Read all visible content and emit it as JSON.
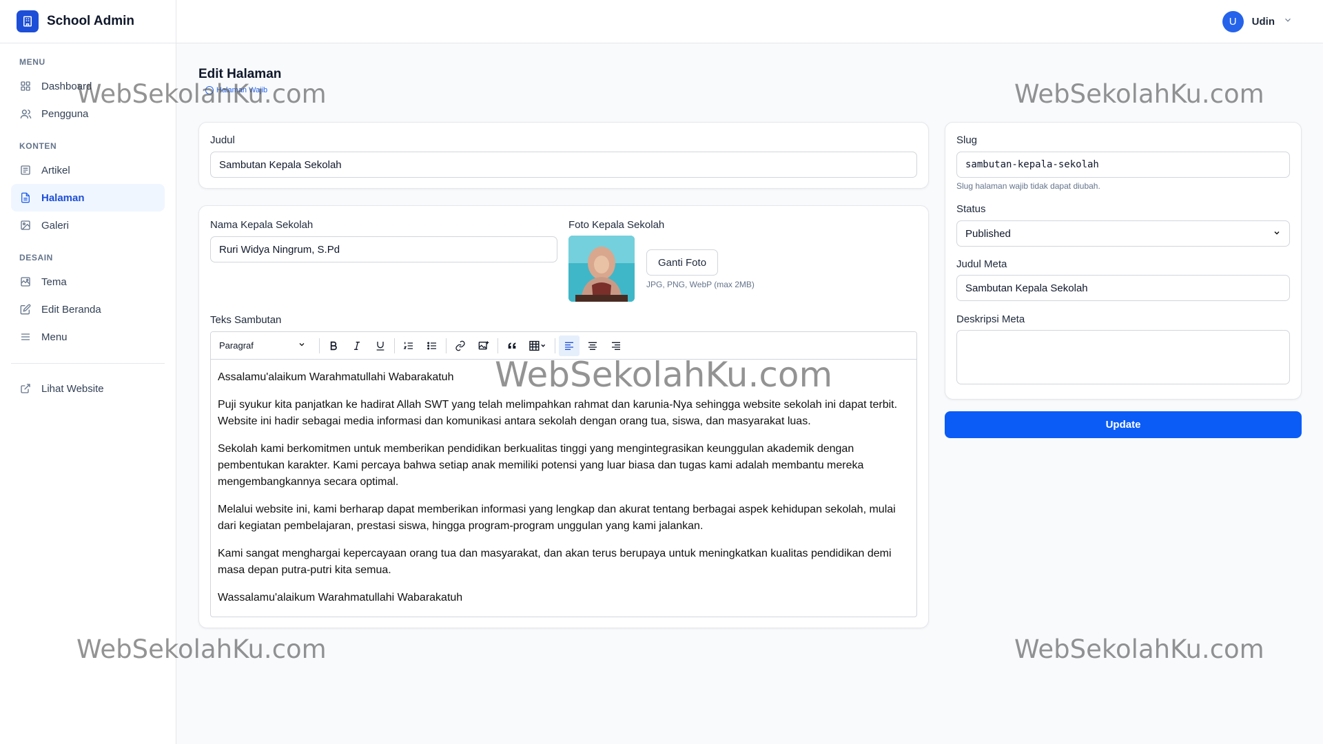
{
  "app": {
    "title": "School Admin"
  },
  "sidebar": {
    "sections": [
      {
        "label": "MENU",
        "items": [
          {
            "label": "Dashboard",
            "icon": "grid-icon"
          },
          {
            "label": "Pengguna",
            "icon": "users-icon"
          }
        ]
      },
      {
        "label": "KONTEN",
        "items": [
          {
            "label": "Artikel",
            "icon": "article-icon"
          },
          {
            "label": "Halaman",
            "icon": "page-icon",
            "active": true
          },
          {
            "label": "Galeri",
            "icon": "image-icon"
          }
        ]
      },
      {
        "label": "DESAIN",
        "items": [
          {
            "label": "Tema",
            "icon": "palette-icon"
          },
          {
            "label": "Edit Beranda",
            "icon": "edit-icon"
          },
          {
            "label": "Menu",
            "icon": "menu-icon"
          }
        ]
      }
    ],
    "footer_link": "Lihat Website"
  },
  "topbar": {
    "avatar_initial": "U",
    "user_name": "Udin"
  },
  "page": {
    "title": "Edit Halaman",
    "badge": "Halaman Wajib"
  },
  "form": {
    "judul_label": "Judul",
    "judul_value": "Sambutan Kepala Sekolah",
    "nama_label": "Nama Kepala Sekolah",
    "nama_value": "Ruri Widya Ningrum, S.Pd",
    "foto_label": "Foto Kepala Sekolah",
    "foto_button": "Ganti Foto",
    "foto_hint": "JPG, PNG, WebP (max 2MB)",
    "teks_label": "Teks Sambutan"
  },
  "editor": {
    "format_select": "Paragraf",
    "paragraphs": [
      "Assalamu'alaikum Warahmatullahi Wabarakatuh",
      "Puji syukur kita panjatkan ke hadirat Allah SWT yang telah melimpahkan rahmat dan karunia-Nya sehingga website sekolah ini dapat terbit. Website ini hadir sebagai media informasi dan komunikasi antara sekolah dengan orang tua, siswa, dan masyarakat luas.",
      "Sekolah kami berkomitmen untuk memberikan pendidikan berkualitas tinggi yang mengintegrasikan keunggulan akademik dengan pembentukan karakter. Kami percaya bahwa setiap anak memiliki potensi yang luar biasa dan tugas kami adalah membantu mereka mengembangkannya secara optimal.",
      "Melalui website ini, kami berharap dapat memberikan informasi yang lengkap dan akurat tentang berbagai aspek kehidupan sekolah, mulai dari kegiatan pembelajaran, prestasi siswa, hingga program-program unggulan yang kami jalankan.",
      "Kami sangat menghargai kepercayaan orang tua dan masyarakat, dan akan terus berupaya untuk meningkatkan kualitas pendidikan demi masa depan putra-putri kita semua.",
      "Wassalamu'alaikum Warahmatullahi Wabarakatuh"
    ]
  },
  "side": {
    "slug_label": "Slug",
    "slug_value": "sambutan-kepala-sekolah",
    "slug_hint": "Slug halaman wajib tidak dapat diubah.",
    "status_label": "Status",
    "status_value": "Published",
    "meta_title_label": "Judul Meta",
    "meta_title_value": "Sambutan Kepala Sekolah",
    "meta_desc_label": "Deskripsi Meta",
    "meta_desc_value": "",
    "update_button": "Update"
  },
  "watermark": "WebSekolahKu.com",
  "colors": {
    "primary": "#0b5cf7",
    "brand": "#1d4ed8",
    "active_bg": "#eff6ff"
  }
}
